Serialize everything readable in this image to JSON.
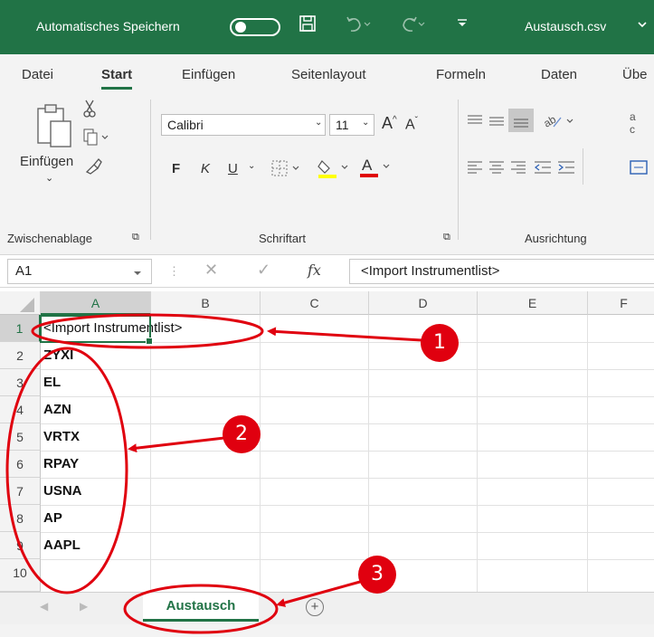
{
  "titlebar": {
    "autosave_label": "Automatisches Speichern",
    "filename": "Austausch.csv",
    "filename_chevron": "⌄",
    "save_icon": "save-icon",
    "undo_icon": "undo-icon",
    "redo_icon": "redo-icon",
    "customize_icon": "customize-qat-icon"
  },
  "tabs": [
    "Datei",
    "Start",
    "Einfügen",
    "Seitenlayout",
    "Formeln",
    "Daten",
    "Übe"
  ],
  "ribbon": {
    "paste_label": "Einfügen",
    "font_name": "Calibri",
    "font_size": "11",
    "bold": "F",
    "italic": "K",
    "underline": "U",
    "group_clipboard": "Zwischenablage",
    "group_font": "Schriftart",
    "group_alignment": "Ausrichtung"
  },
  "formula_bar": {
    "name_box": "A1",
    "fx": "fx",
    "formula": "<Import Instrumentlist>"
  },
  "columns": [
    "A",
    "B",
    "C",
    "D",
    "E",
    "F"
  ],
  "rows": [
    {
      "num": "1",
      "a": "<Import Instrumentlist>"
    },
    {
      "num": "2",
      "a": "ZYXI"
    },
    {
      "num": "3",
      "a": "EL"
    },
    {
      "num": "4",
      "a": "AZN"
    },
    {
      "num": "5",
      "a": "VRTX"
    },
    {
      "num": "6",
      "a": "RPAY"
    },
    {
      "num": "7",
      "a": "USNA"
    },
    {
      "num": "8",
      "a": "AP"
    },
    {
      "num": "9",
      "a": "AAPL"
    },
    {
      "num": "10",
      "a": ""
    }
  ],
  "sheet_tab": "Austausch",
  "add_sheet": "+",
  "annotations": [
    "1",
    "2",
    "3"
  ],
  "colors": {
    "excel_green": "#217346",
    "annotation_red": "#e0000f"
  }
}
